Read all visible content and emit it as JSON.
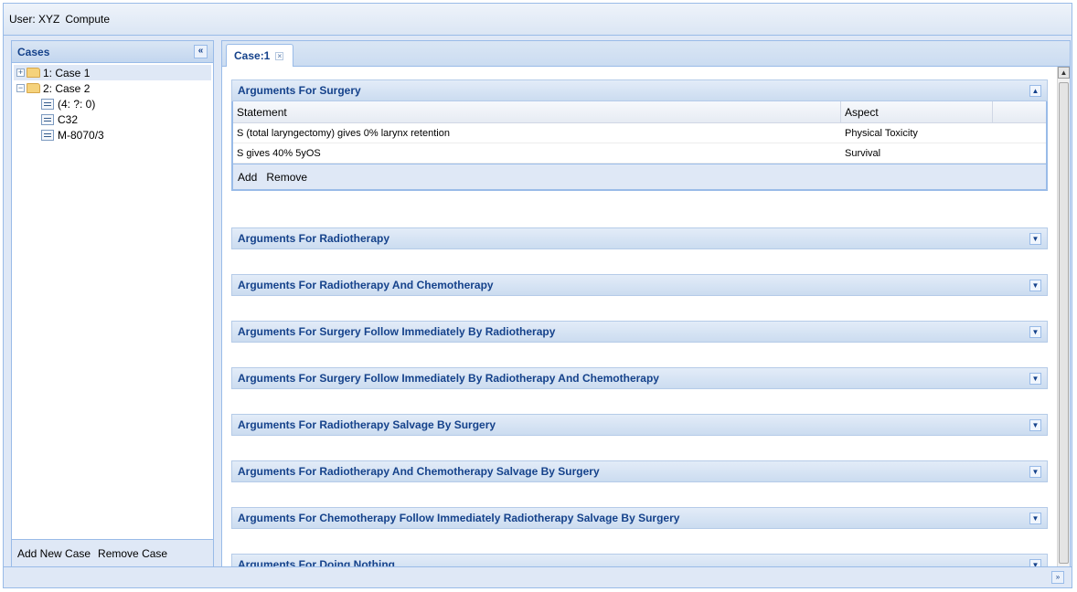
{
  "topbar": {
    "user": "User: XYZ",
    "compute": "Compute"
  },
  "cases_panel": {
    "title": "Cases",
    "collapse_glyph": "«",
    "tree": [
      {
        "toggle": "+",
        "label": "1: Case 1"
      },
      {
        "toggle": "−",
        "label": "2: Case 2"
      }
    ],
    "children": [
      "(4: ?: 0)",
      "C32",
      "M-8070/3"
    ],
    "footer": {
      "add": "Add New Case",
      "remove": "Remove Case"
    }
  },
  "tab": {
    "label": "Case:1",
    "close_glyph": "×"
  },
  "surgery": {
    "title": "Arguments For Surgery",
    "columns": [
      "Statement",
      "Aspect"
    ],
    "rows": [
      {
        "statement": "S (total laryngectomy) gives 0% larynx retention",
        "aspect": "Physical Toxicity"
      },
      {
        "statement": "S gives 40% 5yOS",
        "aspect": "Survival"
      }
    ],
    "toolbar": {
      "add": "Add",
      "remove": "Remove"
    }
  },
  "sections": [
    "Arguments For Radiotherapy",
    "Arguments For Radiotherapy And Chemotherapy",
    "Arguments For Surgery Follow Immediately By Radiotherapy",
    "Arguments For Surgery Follow Immediately By Radiotherapy And Chemotherapy",
    "Arguments For Radiotherapy Salvage By Surgery",
    "Arguments For Radiotherapy And Chemotherapy Salvage By Surgery",
    "Arguments For Chemotherapy Follow Immediately Radiotherapy Salvage By Surgery",
    "Arguments For Doing Nothing"
  ],
  "glyphs": {
    "collapse": "▲",
    "expand": "▼",
    "scroll_up": "▲",
    "footer_expand": "»"
  },
  "colors": {
    "header_text": "#15428b",
    "border": "#99bbe8",
    "panel_bg": "#dfe8f6"
  }
}
